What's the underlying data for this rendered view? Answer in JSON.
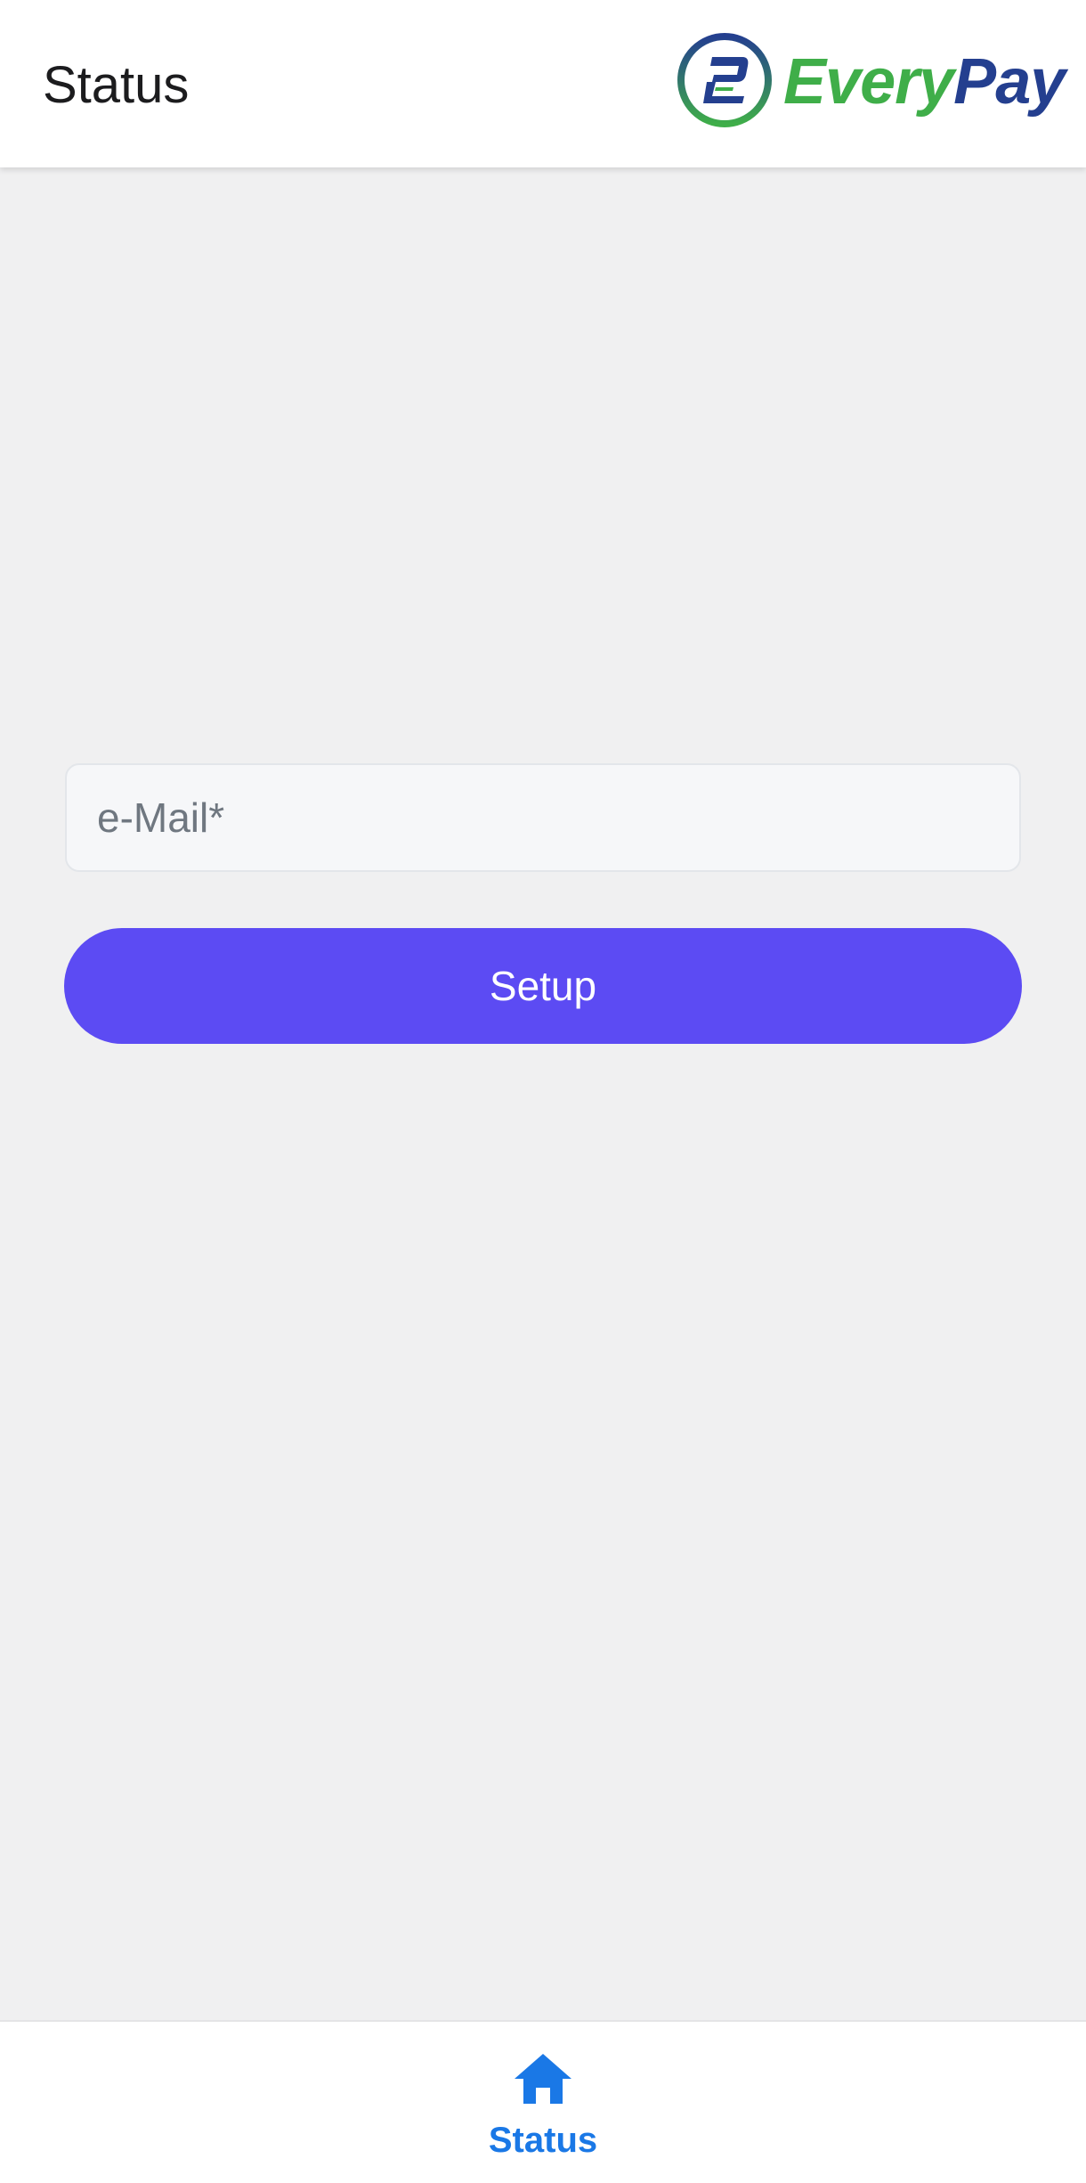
{
  "header": {
    "title": "Status",
    "logo": {
      "word_part1": "Every",
      "word_part2": "Pay",
      "mark_icon": "everypay-e-logo-icon",
      "color_green": "#3fae49",
      "color_blue": "#243f8f"
    }
  },
  "form": {
    "email": {
      "placeholder": "e-Mail*",
      "value": ""
    },
    "setup_label": "Setup",
    "accent_color": "#5c4bf3"
  },
  "bottom_nav": {
    "items": [
      {
        "label": "Status",
        "icon": "home-icon",
        "active": true,
        "color": "#1a78e6"
      }
    ]
  }
}
